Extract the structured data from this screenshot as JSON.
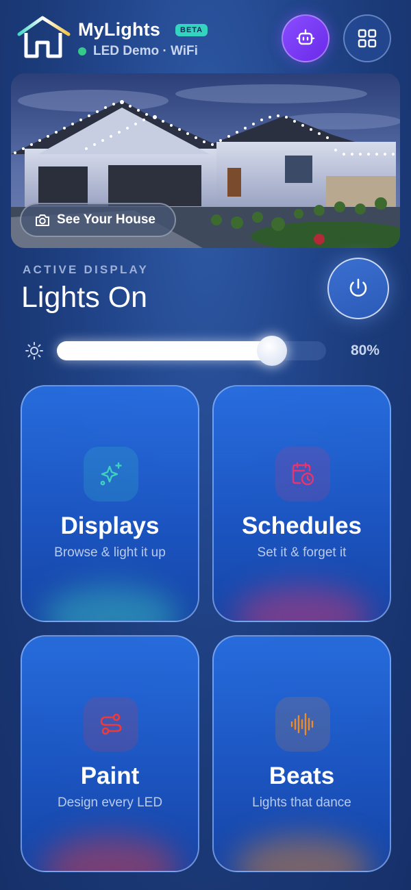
{
  "header": {
    "app_title": "MyLights",
    "badge": "BETA",
    "status": "LED Demo · WiFi",
    "status_color": "#35c98a",
    "icons": {
      "logo": "house-logo-icon",
      "assistant": "robot-icon",
      "menu": "grid-icon"
    }
  },
  "hero": {
    "button_label": "See Your House",
    "button_icon": "camera-icon"
  },
  "active_display": {
    "label": "ACTIVE DISPLAY",
    "value": "Lights On",
    "power_icon": "power-icon"
  },
  "brightness": {
    "icon": "sun-icon",
    "value_percent": 80,
    "label": "80%"
  },
  "cards": [
    {
      "id": "displays",
      "title": "Displays",
      "subtitle": "Browse & light it up",
      "icon": "sparkles-icon",
      "accent": "#3fd0c0"
    },
    {
      "id": "schedules",
      "title": "Schedules",
      "subtitle": "Set it & forget it",
      "icon": "calendar-clock-icon",
      "accent": "#e8356e"
    },
    {
      "id": "paint",
      "title": "Paint",
      "subtitle": "Design every LED",
      "icon": "paint-path-icon",
      "accent": "#ef3a3a"
    },
    {
      "id": "beats",
      "title": "Beats",
      "subtitle": "Lights that dance",
      "icon": "audio-wave-icon",
      "accent": "#f08a24"
    }
  ]
}
